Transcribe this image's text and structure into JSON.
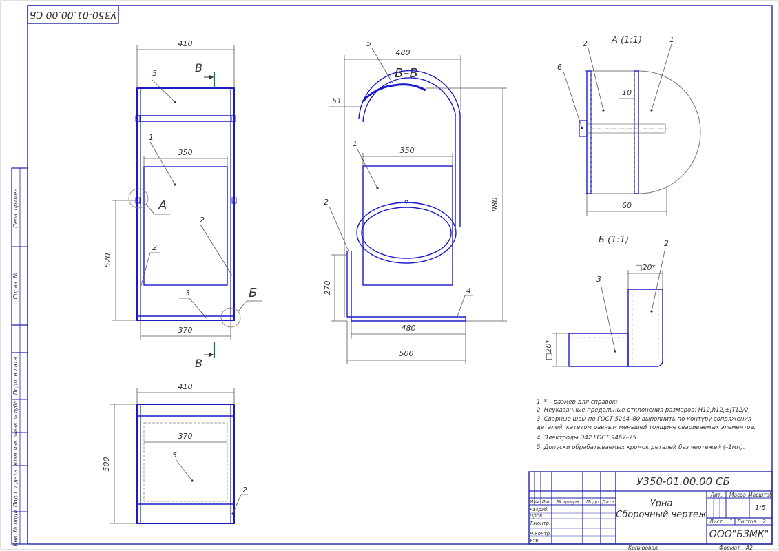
{
  "stamp_code_rotated": "У350-01.00.00 СБ",
  "views": {
    "front": {
      "dim_top": "410",
      "dim_inner": "350",
      "dim_height": "520",
      "dim_bottom": "370",
      "callout_1": "1",
      "callout_2a": "2",
      "callout_2b": "2",
      "callout_3": "3",
      "callout_5": "5",
      "detail_a": "А",
      "detail_b": "Б",
      "section_mark_top": "В",
      "section_mark_bottom": "В"
    },
    "section": {
      "title": "В–В",
      "dim_top": "480",
      "dim_51": "51",
      "dim_inner": "350",
      "dim_height": "980",
      "dim_270": "270",
      "dim_480": "480",
      "dim_500": "500",
      "callout_1": "1",
      "callout_2": "2",
      "callout_4": "4",
      "callout_5": "5"
    },
    "top": {
      "dim_top": "410",
      "dim_inner": "370",
      "dim_height": "500",
      "callout_5": "5",
      "callout_2": "2"
    },
    "detail_a": {
      "title": "А (1:1)",
      "callout_1": "1",
      "callout_2": "2",
      "callout_6": "6",
      "dim_10": "10",
      "dim_60": "60"
    },
    "detail_b": {
      "title": "Б (1:1)",
      "callout_2": "2",
      "callout_3": "3",
      "dim_top": "□20*",
      "dim_side": "□20*"
    }
  },
  "notes": [
    "1. * – размер для справок;",
    "2. Неуказанные предельные отклонения размеров: H12,h12,±JT12/2,",
    "3. Сварные швы по ГОСТ 5264–80 выполнить по контуру сопряжения",
    "деталей, катетом равным меньшей толщине свариваемых элементов.",
    "4. Электроды Э42 ГОСТ 9467–75",
    "5. Допуски обрабатываемых кромок деталей без чертежей (–1мм)."
  ],
  "title_block": {
    "document_code": "У350-01.00.00 СБ",
    "name_line1": "Урна",
    "name_line2": "Сборочный чертеж",
    "col_izm": "Изм",
    "col_list": "Лист",
    "col_doc": "№ докум.",
    "col_sign": "Подп.",
    "col_date": "Дата",
    "row_razrab": "Разраб.",
    "row_prov": "Пров.",
    "row_tkontr": "Т.контр.",
    "row_nkontr": "Н.контр.",
    "row_utv": "Утв.",
    "lit_label": "Лит.",
    "mass_label": "Масса",
    "scale_label": "Масштаб",
    "scale_value": "1:5",
    "sheet_label": "Лист",
    "sheet_value": "1",
    "sheets_label": "Листов",
    "sheets_value": "2",
    "organization": "ООО\"БЗМК\"",
    "copied_label": "Копировал",
    "format_label": "Формат",
    "format_value": "А2"
  },
  "left_strip": [
    "Перв. примен.",
    "Справ. №",
    "Подп. и дата",
    "Инв. № дубл.",
    "Взам. инв. №",
    "Подп. и дата",
    "Инв. № подл."
  ],
  "colors": {
    "part_lines": "#1a1ac8",
    "frame": "#2222aa",
    "dimension_lines": "#555555"
  }
}
